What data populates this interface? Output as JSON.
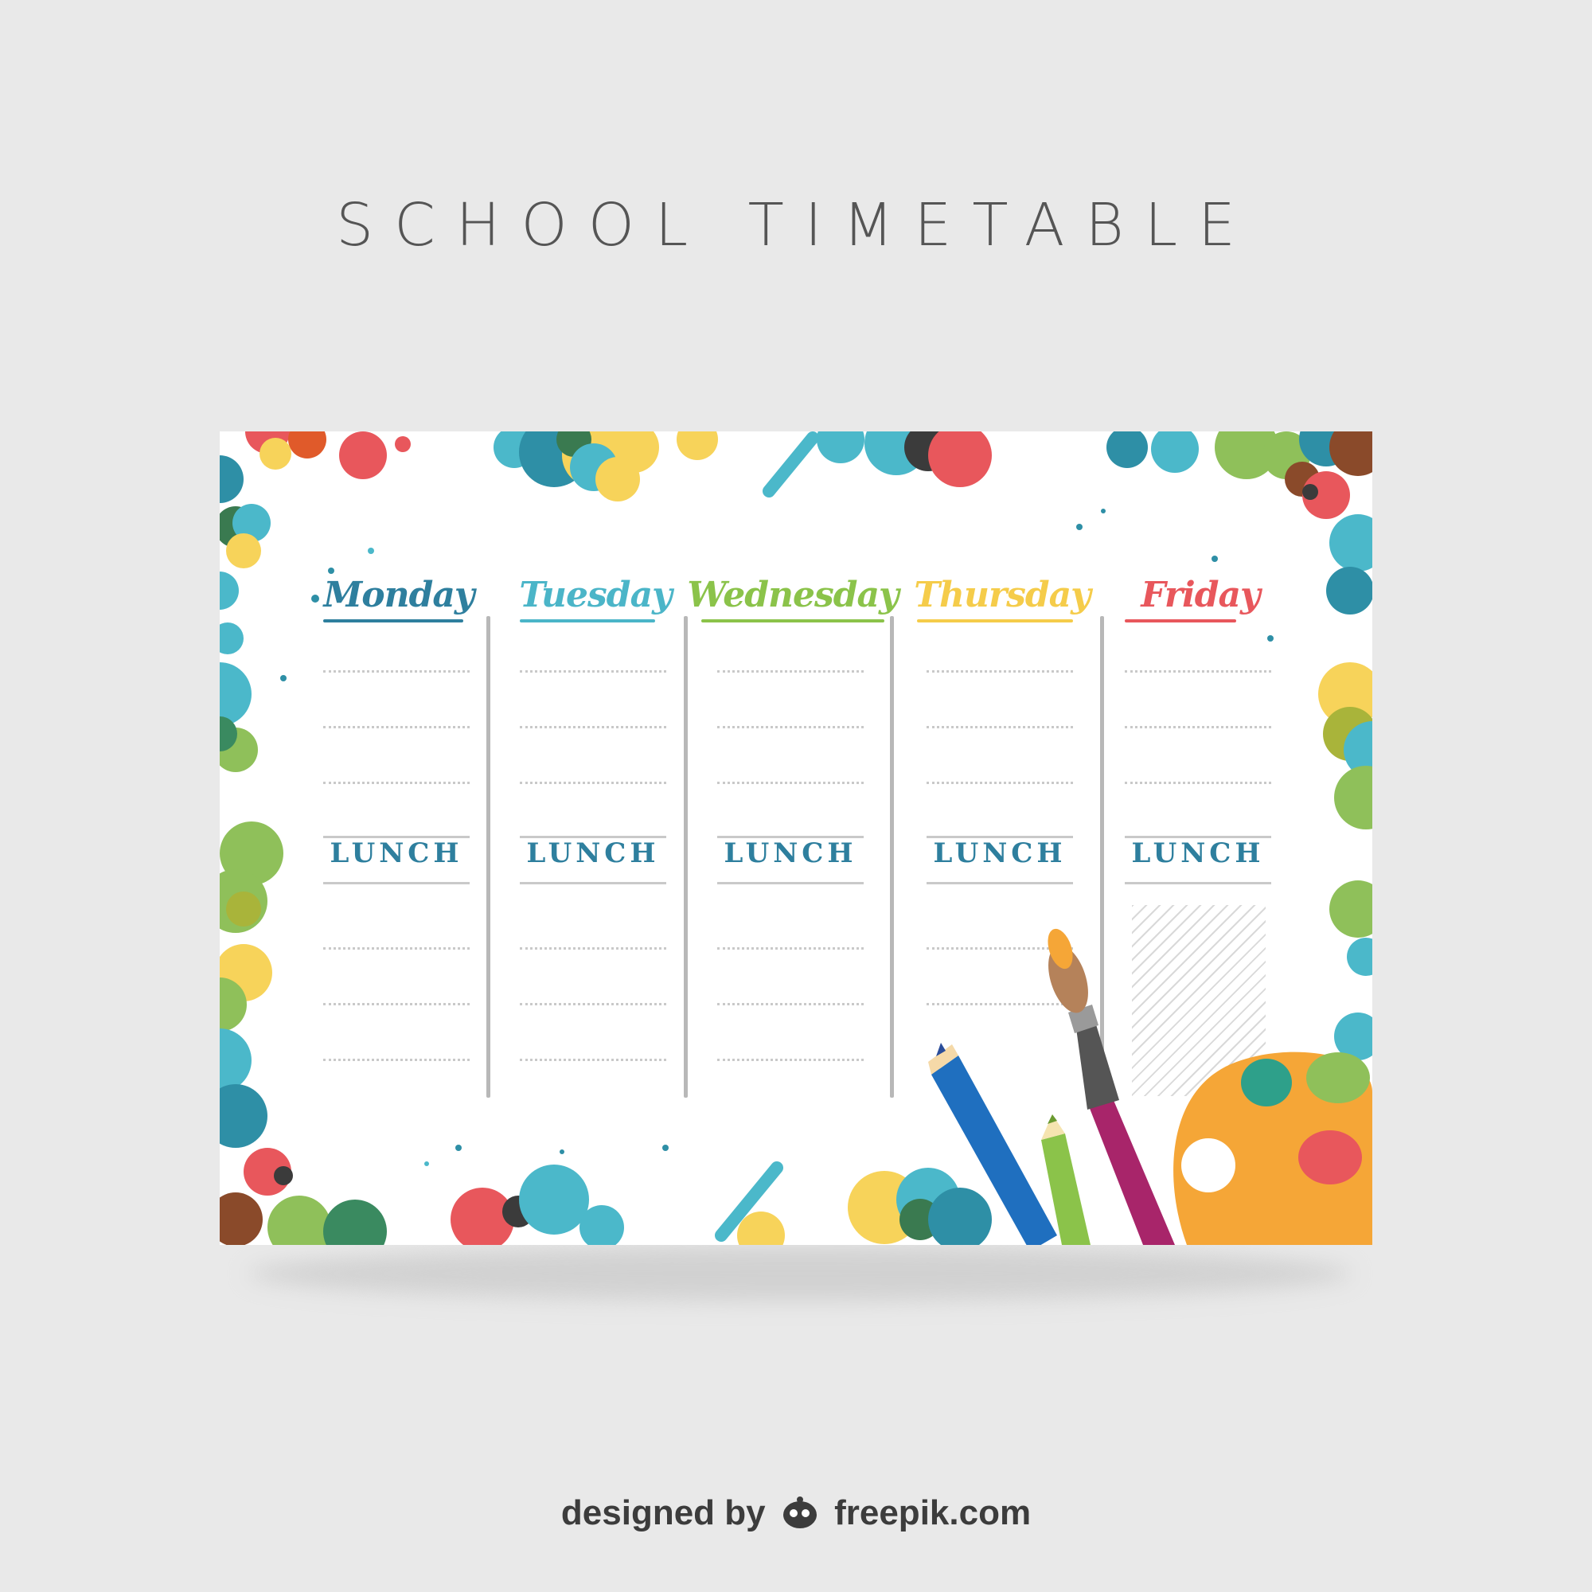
{
  "title": "SCHOOL TIMETABLE",
  "days": [
    {
      "name": "Monday",
      "color": "#2e7f9e"
    },
    {
      "name": "Tuesday",
      "color": "#4bb5c8"
    },
    {
      "name": "Wednesday",
      "color": "#8bc34a"
    },
    {
      "name": "Thursday",
      "color": "#f5cc4a"
    },
    {
      "name": "Friday",
      "color": "#e8575c"
    }
  ],
  "lunch_label": "LUNCH",
  "lunch_color": "#2e7f9e",
  "credit": {
    "prefix": "designed by",
    "site": "freepik.com"
  },
  "palette_colors": {
    "teal": "#2e8fa6",
    "cyan": "#4bb8ca",
    "green": "#8fc05a",
    "yellow": "#f7d35a",
    "red": "#e8575c",
    "brown": "#8a4a2a",
    "orange": "#f5a637"
  },
  "icons": [
    "paint-splatter",
    "pencil-icon",
    "paintbrush-icon",
    "paint-palette-icon",
    "freepik-mascot-icon"
  ]
}
